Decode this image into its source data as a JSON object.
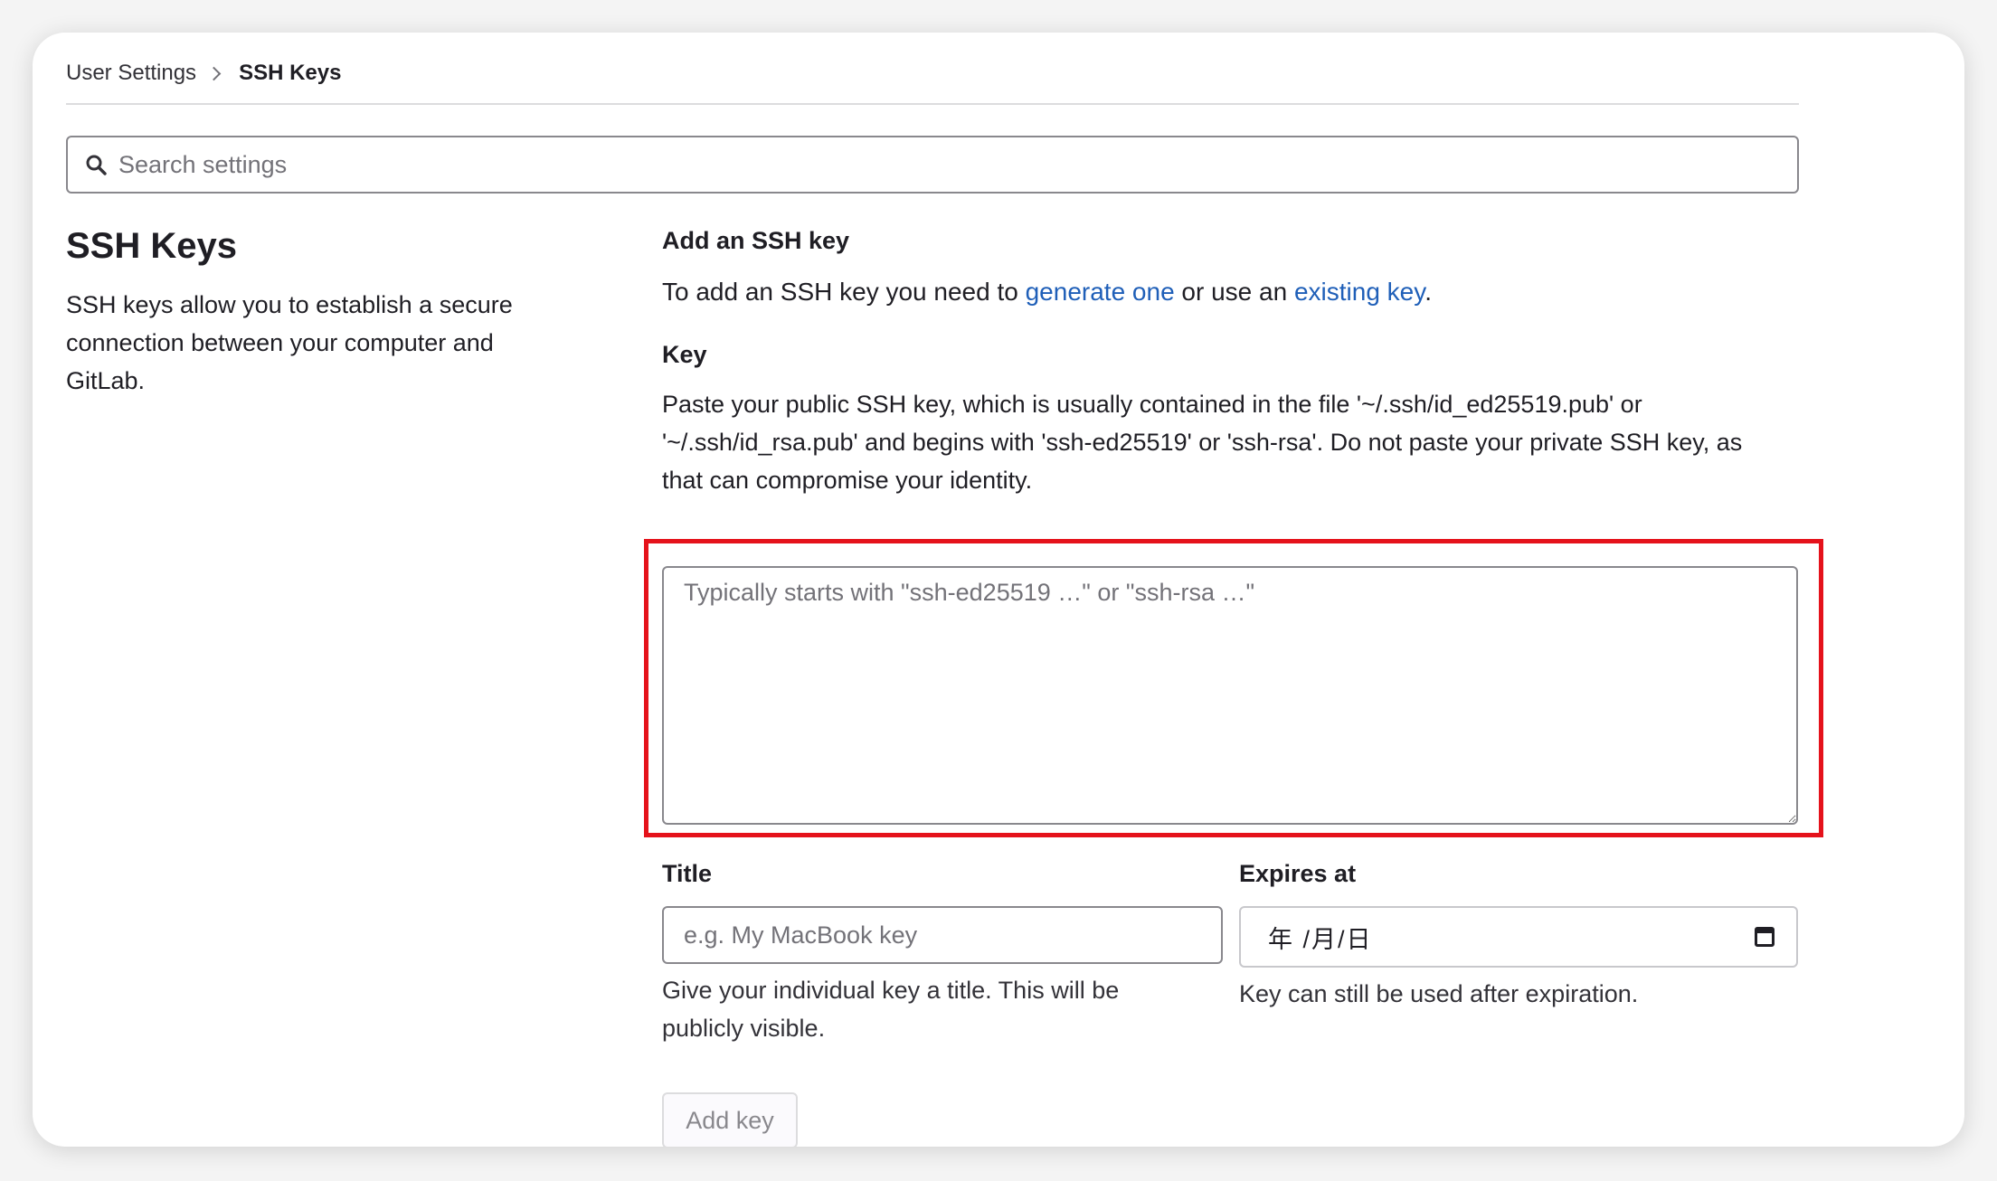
{
  "breadcrumb": {
    "parent": "User Settings",
    "current": "SSH Keys"
  },
  "search": {
    "placeholder": "Search settings",
    "icon": "search-icon"
  },
  "section": {
    "title": "SSH Keys",
    "description": "SSH keys allow you to establish a secure connection between your computer and GitLab."
  },
  "add_key": {
    "heading": "Add an SSH key",
    "intro_prefix": "To add an SSH key you need to ",
    "generate_link": "generate one",
    "intro_middle": " or use an ",
    "existing_link": "existing key",
    "intro_suffix": "."
  },
  "key_field": {
    "label": "Key",
    "help": "Paste your public SSH key, which is usually contained in the file '~/.ssh/id_ed25519.pub' or '~/.ssh/id_rsa.pub' and begins with 'ssh-ed25519' or 'ssh-rsa'. Do not paste your private SSH key, as that can compromise your identity.",
    "placeholder": "Typically starts with \"ssh-ed25519 …\" or \"ssh-rsa …\"",
    "value": ""
  },
  "title_field": {
    "label": "Title",
    "placeholder": "e.g. My MacBook key",
    "help": "Give your individual key a title. This will be publicly visible."
  },
  "expires_field": {
    "label": "Expires at",
    "display": "年 /月/日",
    "help": "Key can still be used after expiration.",
    "icon": "calendar-icon"
  },
  "submit": {
    "label": "Add key",
    "disabled": true
  },
  "colors": {
    "link": "#1f5fb8",
    "highlight_border": "#e5121b"
  }
}
